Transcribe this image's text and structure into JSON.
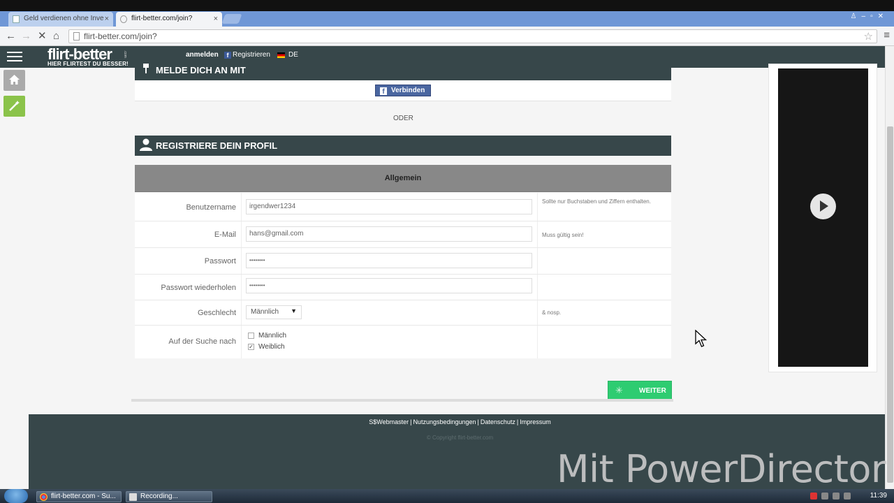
{
  "browser": {
    "tabs": [
      {
        "title": "Geld verdienen ohne Inve"
      },
      {
        "title": "flirt-better.com/join?"
      }
    ],
    "url": "flirt-better.com/join?"
  },
  "site": {
    "logo_main": "flirt-better",
    "logo_sub": "HIER FLIRTEST DU BESSER!",
    "logo_small": ".com",
    "nav": {
      "login": "anmelden",
      "register": "Registrieren",
      "language": "DE"
    }
  },
  "login_section": {
    "heading": "MELDE DICH AN MIT",
    "facebook_button": "Verbinden",
    "or_text": "ODER"
  },
  "register_section": {
    "heading": "REGISTRIERE DEIN PROFIL",
    "subheading": "Allgemein",
    "fields": {
      "username": {
        "label": "Benutzername",
        "value": "irgendwer1234",
        "hint": "Sollte nur Buchstaben und Ziffern enthalten."
      },
      "email": {
        "label": "E-Mail",
        "value": "hans@gmail.com",
        "hint": "Muss gültig sein!"
      },
      "password": {
        "label": "Passwort",
        "value": "••••••••"
      },
      "password_repeat": {
        "label": "Passwort wiederholen",
        "value": "••••••••"
      },
      "gender": {
        "label": "Geschlecht",
        "value": "Männlich",
        "hint": "& nosp."
      },
      "looking_for": {
        "label": "Auf der Suche nach",
        "options": [
          {
            "label": "Männlich",
            "checked": false
          },
          {
            "label": "Weiblich",
            "checked": true
          }
        ]
      }
    },
    "submit": "WEITER"
  },
  "footer": {
    "links": [
      "S$Webmaster",
      "Nutzungsbedingungen",
      "Datenschutz",
      "Impressum"
    ],
    "copyright": "© Copyright flirt-better.com"
  },
  "watermark": "Mit PowerDirector",
  "taskbar": {
    "tasks": [
      {
        "title": "flirt-better.com - Su..."
      },
      {
        "title": "Recording..."
      }
    ],
    "clock": "11:39"
  },
  "colors": {
    "nav_bg": "#37474a",
    "submit_green": "#2ecc71",
    "facebook_blue": "#4a66a0"
  }
}
